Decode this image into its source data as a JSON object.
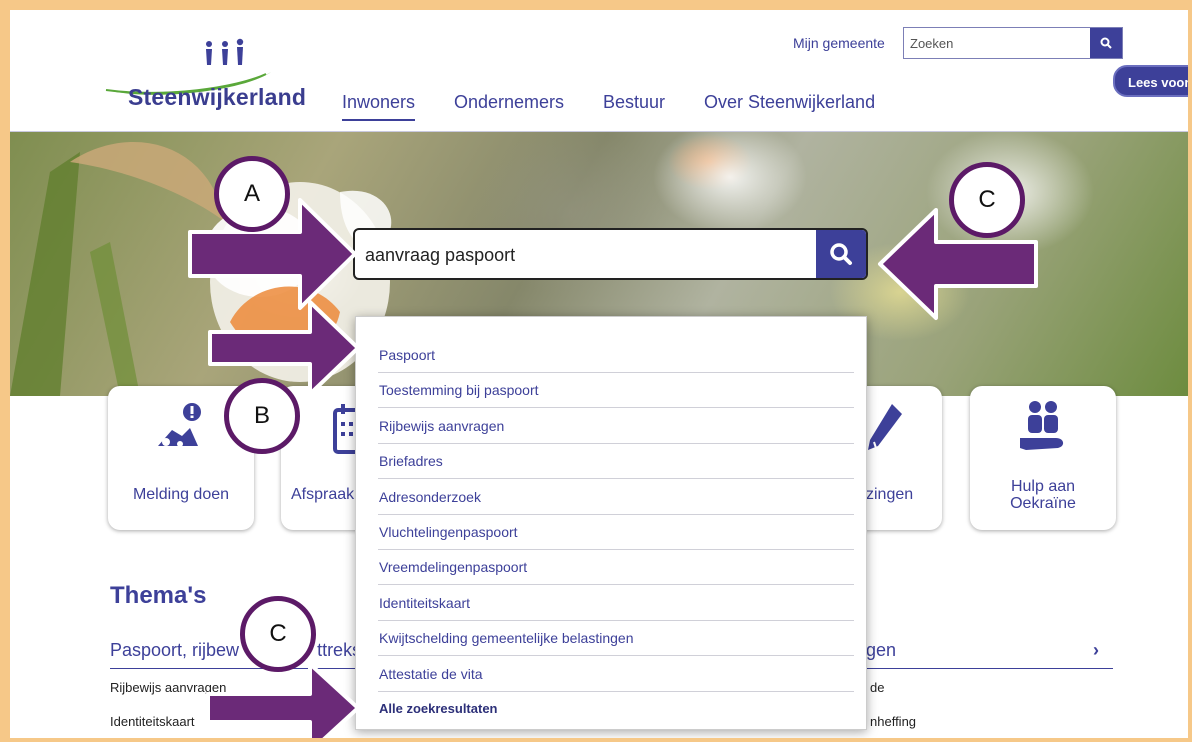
{
  "header": {
    "logo_text": "Steenwijkerland",
    "mijn_gemeente": "Mijn gemeente",
    "search_placeholder": "Zoeken",
    "lees_voor": "Lees voor",
    "nav": [
      "Inwoners",
      "Ondernemers",
      "Bestuur",
      "Over Steenwijkerland"
    ]
  },
  "hero": {
    "search_value": "aanvraag paspoort"
  },
  "dropdown": {
    "items": [
      "Paspoort",
      "Toestemming bij paspoort",
      "Rijbewijs aanvragen",
      "Briefadres",
      "Adresonderzoek",
      "Vluchtelingenpaspoort",
      "Vreemdelingenpaspoort",
      "Identiteitskaart",
      "Kwijtschelding gemeentelijke belastingen",
      "Attestatie de vita"
    ],
    "all_results": "Alle zoekresultaten"
  },
  "tiles": [
    {
      "label": "Melding doen",
      "icon": "report-icon"
    },
    {
      "label": "Afspraak",
      "icon": "calendar-icon"
    },
    {
      "label": "zingen",
      "icon": "pencil-icon"
    },
    {
      "label": "Hulp aan\nOekraïne",
      "icon": "helping-hand-icon"
    }
  ],
  "themes": {
    "title": "Thema's",
    "left_heading_a": "Paspoort, rijbew",
    "left_heading_b": "ttreks",
    "left_links": [
      "Rijbewijs aanvragen",
      "Identiteitskaart"
    ],
    "right_heading": "gen",
    "right_chevron": "›",
    "right_links": [
      "de",
      "nheffing"
    ]
  },
  "annotations": {
    "label_a": "A",
    "label_b": "B",
    "label_c_top": "C",
    "label_c_bottom": "C",
    "arrow_color": "#6b2a78",
    "circle_border": "#5c1a67"
  },
  "colors": {
    "brand": "#3d4099",
    "frame": "#f6c888"
  }
}
